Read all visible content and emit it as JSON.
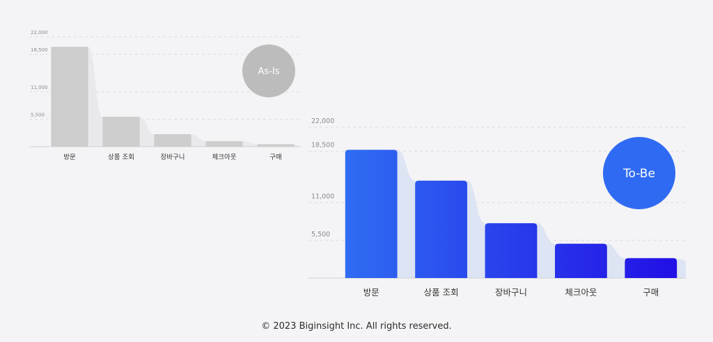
{
  "colors": {
    "as_is_bar": "#cdcdcd",
    "as_is_badge": "#bcbcbc",
    "to_be_badge": "#2f6bf2",
    "to_be_bar_start": "#2f6cf2",
    "to_be_bar_end": "#2211e6",
    "grid": "#dcdcde",
    "as_is_area": "#e9e9eb",
    "to_be_area": "#dde4f4",
    "tick_text": "#8a8a8a",
    "cat_text": "#333333"
  },
  "chart_data": [
    {
      "type": "bar",
      "badge": "As-Is",
      "categories": [
        "방문",
        "상품 조회",
        "장바구니",
        "체크아웃",
        "구매"
      ],
      "values": [
        20000,
        6000,
        2500,
        1100,
        500
      ],
      "yticks": [
        "5,500",
        "11,000",
        "18,500",
        "22,000"
      ],
      "ylim": [
        0,
        22000
      ],
      "grid": true
    },
    {
      "type": "bar",
      "badge": "To-Be",
      "categories": [
        "방문",
        "상품 조회",
        "장바구니",
        "체크아웃",
        "구매"
      ],
      "values": [
        18700,
        14200,
        8000,
        5000,
        2900
      ],
      "yticks": [
        "5,500",
        "11,000",
        "18,500",
        "22,000"
      ],
      "ylim": [
        0,
        22000
      ],
      "grid": true
    }
  ],
  "footer": "© 2023 Biginsight Inc. All rights reserved."
}
